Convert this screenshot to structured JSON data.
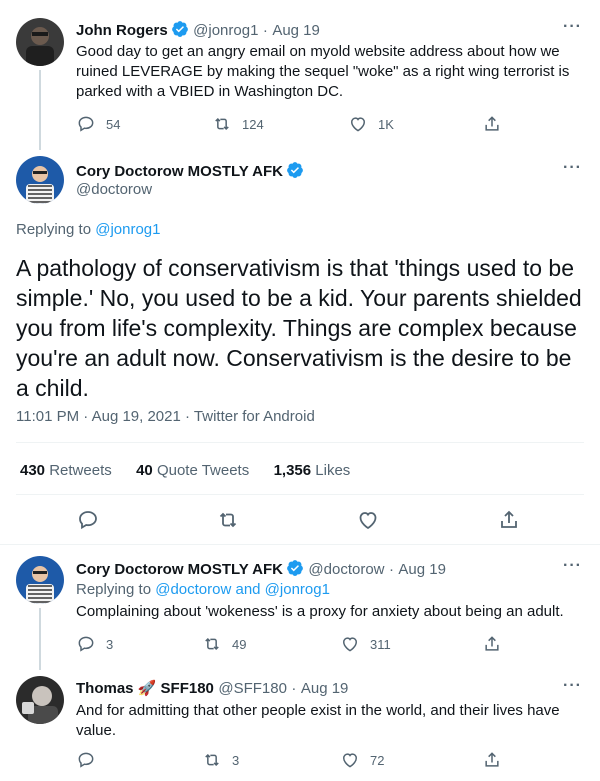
{
  "tweet1": {
    "name": "John Rogers",
    "handle": "@jonrog1",
    "date": "Aug 19",
    "text": "Good day to get an angry email on myold website address about how we ruined LEVERAGE by making the sequel \"woke\" as a right wing terrorist is parked with a VBIED in Washington DC.",
    "replies": "54",
    "retweets": "124",
    "likes": "1K"
  },
  "main": {
    "name": "Cory Doctorow MOSTLY AFK",
    "handle": "@doctorow",
    "replying_prefix": "Replying to",
    "replying_to": "@jonrog1",
    "text": "A pathology of conservativism is that 'things used to be simple.' No, you used to be a kid. Your parents shielded you from life's complexity. Things are complex because you're an adult now. Conservativism is the desire to be a child.",
    "time": "11:01 PM · Aug 19, 2021 · Twitter for Android",
    "stats": {
      "retweets_count": "430",
      "retweets_label": "Retweets",
      "quotes_count": "40",
      "quotes_label": "Quote Tweets",
      "likes_count": "1,356",
      "likes_label": "Likes"
    }
  },
  "reply1": {
    "name": "Cory Doctorow MOSTLY AFK",
    "handle": "@doctorow",
    "date": "Aug 19",
    "replying_prefix": "Replying to",
    "replying_to": "@doctorow and @jonrog1",
    "text": "Complaining about 'wokeness' is a proxy for anxiety about being an adult.",
    "replies": "3",
    "retweets": "49",
    "likes": "311"
  },
  "reply2": {
    "name_first": "Thomas",
    "name_emoji": "🚀",
    "name_last": "SFF180",
    "handle": "@SFF180",
    "date": "Aug 19",
    "text": "And for admitting that other people exist in the world, and their lives have value.",
    "replies": "",
    "retweets": "3",
    "likes": "72"
  },
  "separator": "·",
  "colors": {
    "link": "#1d9bf0",
    "muted": "#536471",
    "text": "#0f1419",
    "verified": "#1d9bf0"
  }
}
